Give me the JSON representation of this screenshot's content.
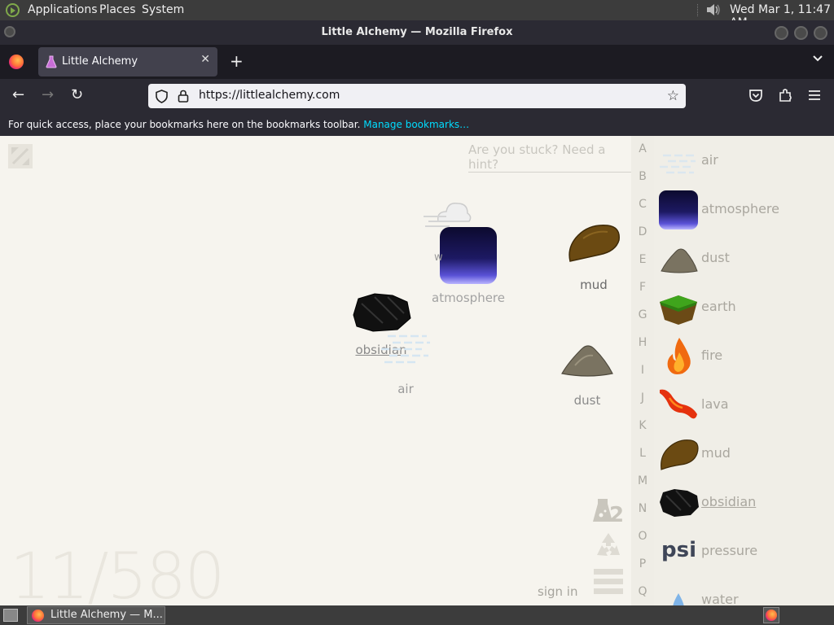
{
  "top_panel": {
    "menus": [
      "Applications",
      "Places",
      "System"
    ],
    "clock": "Wed Mar  1, 11:47 AM",
    "icons": [
      "app-logo-icon",
      "volume-icon"
    ]
  },
  "window": {
    "title": "Little Alchemy — Mozilla Firefox"
  },
  "tabs": {
    "active_title": "Little Alchemy",
    "close_glyph": "✕",
    "new_tab_glyph": "+",
    "list_glyph": "⌄"
  },
  "navbar": {
    "back_glyph": "←",
    "forward_glyph": "→",
    "reload_glyph": "↻",
    "url": "https://littlealchemy.com",
    "bookmark_glyph": "☆"
  },
  "bookmarks_bar": {
    "message": "For quick access, place your bookmarks here on the bookmarks toolbar.",
    "manage_link": "Manage bookmarks…"
  },
  "game": {
    "hint_link": "Are you stuck? Need a hint?",
    "counter": "11/580",
    "sign_in": "sign in",
    "encyclopedia_badge": "2",
    "workspace_items": [
      {
        "name": "air",
        "label": ""
      },
      {
        "name": "atmosphere",
        "label": "atmosphere"
      },
      {
        "name": "mud",
        "label": "mud"
      },
      {
        "name": "obsidian",
        "label": "obsidian"
      },
      {
        "name": "air",
        "label": "air"
      },
      {
        "name": "dust",
        "label": "dust"
      }
    ],
    "alphabet": [
      "A",
      "B",
      "C",
      "D",
      "E",
      "F",
      "G",
      "H",
      "I",
      "J",
      "K",
      "L",
      "M",
      "N",
      "O",
      "P",
      "Q"
    ],
    "library": [
      {
        "name": "air",
        "label": "air"
      },
      {
        "name": "atmosphere",
        "label": "atmosphere"
      },
      {
        "name": "dust",
        "label": "dust"
      },
      {
        "name": "earth",
        "label": "earth"
      },
      {
        "name": "fire",
        "label": "fire"
      },
      {
        "name": "lava",
        "label": "lava"
      },
      {
        "name": "mud",
        "label": "mud"
      },
      {
        "name": "obsidian",
        "label": "obsidian"
      },
      {
        "name": "pressure",
        "label": "pressure",
        "icon_text": "psi"
      },
      {
        "name": "water",
        "label": "water"
      }
    ]
  },
  "taskbar": {
    "window_label": "Little Alchemy — M..."
  },
  "colors": {
    "page_bg": "#f6f4ee",
    "library_bg": "#f0eee7",
    "firefox_dark": "#2b2a33",
    "link_cyan": "#00ddff"
  }
}
